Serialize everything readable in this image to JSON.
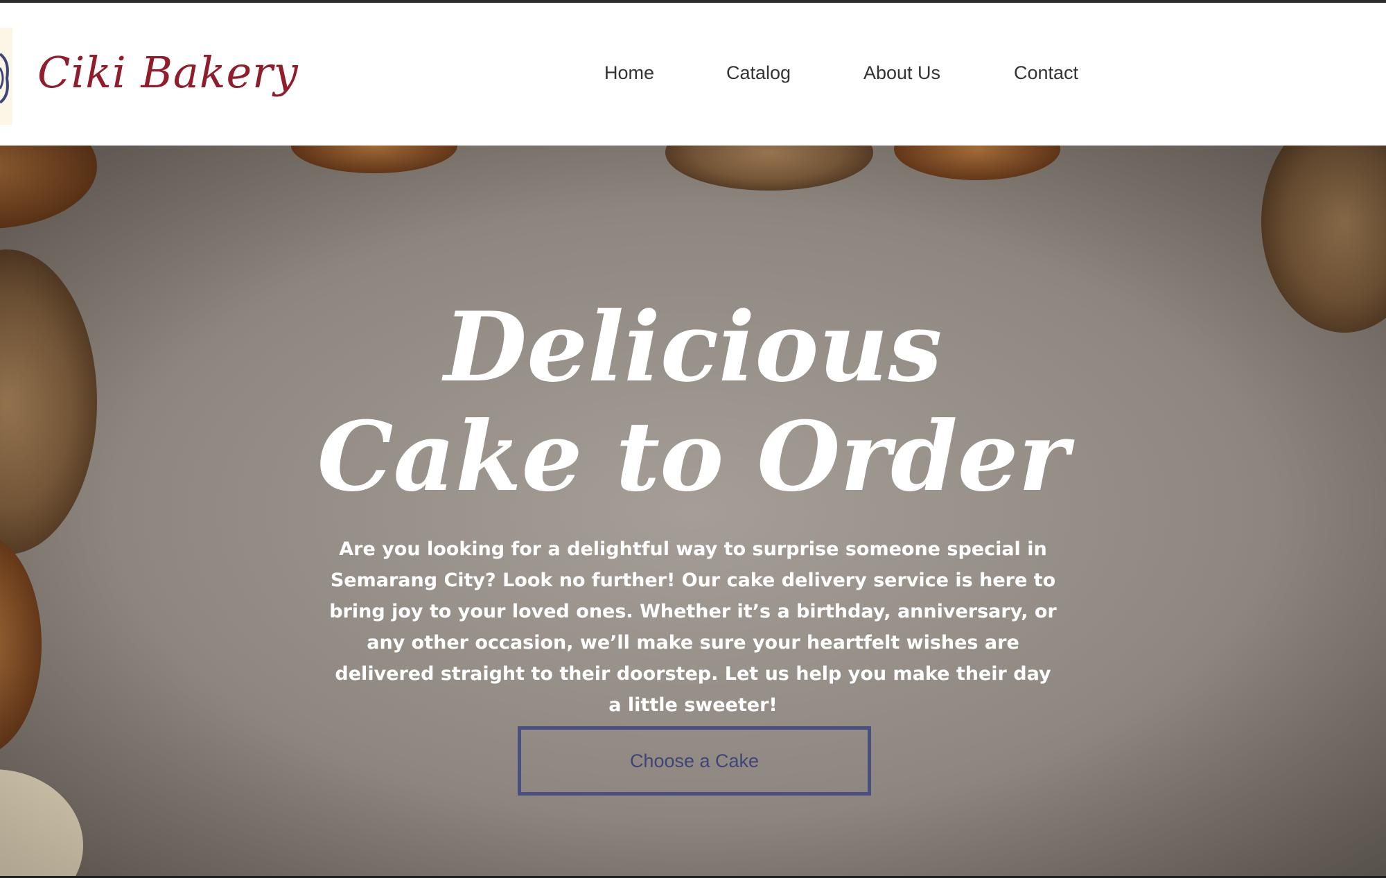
{
  "brand": {
    "name": "Ciki Bakery",
    "accent_color": "#8f1d2c",
    "emblem_icon": "bakery-emblem-icon"
  },
  "nav": {
    "items": [
      {
        "label": "Home"
      },
      {
        "label": "Catalog"
      },
      {
        "label": "About Us"
      },
      {
        "label": "Contact"
      }
    ]
  },
  "hero": {
    "title_line1": "Delicious",
    "title_line2": "Cake to Order",
    "description": "Are you looking for a delightful way to surprise someone special in Semarang City? Look no further! Our cake delivery service is here to bring joy to your loved ones. Whether it’s a birthday, anniversary, or any other occasion, we’ll make sure your heartfelt wishes are delivered straight to their doorstep. Let us help you make their day a little sweeter!",
    "cta_label": "Choose a Cake",
    "cta_border_color": "#4a4f82",
    "background_image": "bread-slices-on-stone-table"
  }
}
